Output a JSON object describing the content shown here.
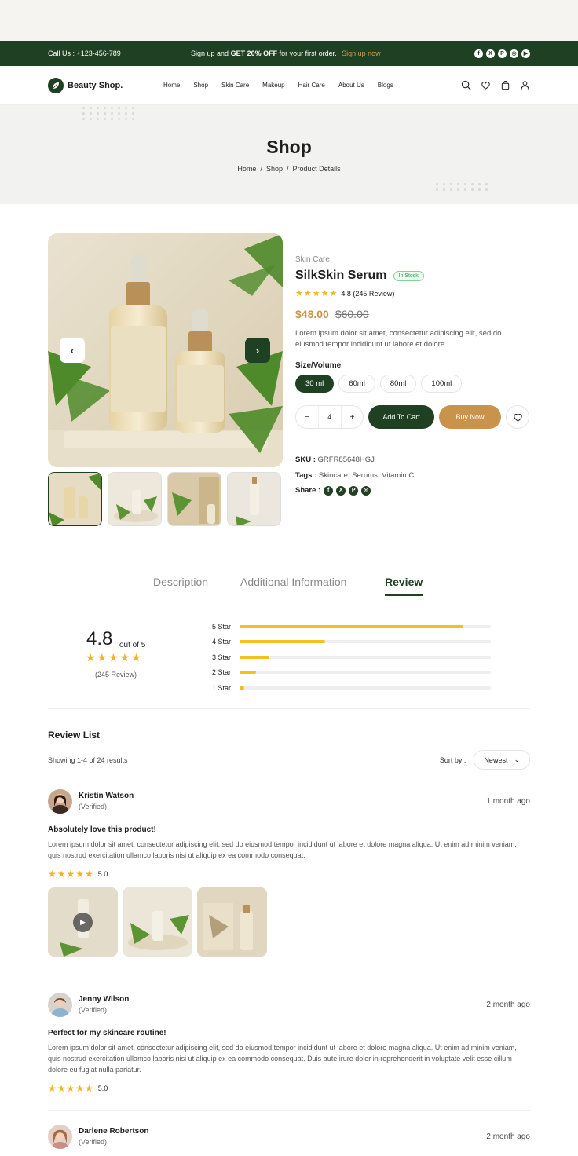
{
  "topbar": {
    "call": "Call Us : +123-456-789",
    "promo_prefix": "Sign up and",
    "promo_bold": "GET 20% OFF",
    "promo_suffix": "for your first order.",
    "promo_link": "Sign up now",
    "socials": [
      "facebook-icon",
      "x-icon",
      "pinterest-icon",
      "instagram-icon",
      "youtube-icon"
    ]
  },
  "nav": {
    "brand": "Beauty Shop.",
    "menu": [
      "Home",
      "Shop",
      "Skin Care",
      "Makeup",
      "Hair Care",
      "About Us",
      "Blogs"
    ],
    "icons": [
      "search-icon",
      "heart-icon",
      "bag-icon",
      "user-icon"
    ]
  },
  "hero": {
    "title": "Shop",
    "crumbs": [
      "Home",
      "Shop",
      "Product Details"
    ]
  },
  "product": {
    "category": "Skin Care",
    "name": "SilkSkin Serum",
    "stock": "In Stock",
    "rating_text": "4.8 (245 Review)",
    "rating_value": 4.8,
    "price": "$48.00",
    "old_price": "$60.00",
    "description": "Lorem ipsum dolor sit amet, consectetur adipiscing elit, sed do eiusmod tempor incididunt ut labore et dolore.",
    "size_label": "Size/Volume",
    "sizes": [
      "30 ml",
      "60ml",
      "80ml",
      "100ml"
    ],
    "selected_size": "30 ml",
    "quantity": "4",
    "add_to_cart": "Add To Cart",
    "buy_now": "Buy Now",
    "sku_label": "SKU :",
    "sku": "GRFR85648HGJ",
    "tags_label": "Tags :",
    "tags": "Skincare, Serums, Vitamin C",
    "share_label": "Share :"
  },
  "tabs": {
    "items": [
      "Description",
      "Additional Information",
      "Review"
    ],
    "active": "Review"
  },
  "summary": {
    "score": "4.8",
    "out_of": "out of 5",
    "count": "(245 Review)",
    "bars": [
      {
        "label": "5 Star",
        "fraction": 0.89
      },
      {
        "label": "4 Star",
        "fraction": 0.34
      },
      {
        "label": "3 Star",
        "fraction": 0.12
      },
      {
        "label": "2 Star",
        "fraction": 0.065
      },
      {
        "label": "1 Star",
        "fraction": 0.02
      }
    ]
  },
  "reviews_header": {
    "title": "Review List",
    "showing": "Showing 1-4 of 24 results",
    "sort_label": "Sort by :",
    "sort_value": "Newest"
  },
  "reviews": [
    {
      "name": "Kristin Watson",
      "verified": "(Verified)",
      "time": "1 month ago",
      "title": "Absolutely love this product!",
      "body": "Lorem ipsum dolor sit amet, consectetur adipiscing elit, sed do eiusmod tempor incididunt ut labore et dolore magna aliqua. Ut enim ad minim veniam, quis nostrud exercitation ullamco laboris nisi ut aliquip ex ea commodo consequat.",
      "score": "5.0"
    },
    {
      "name": "Jenny Wilson",
      "verified": "(Verified)",
      "time": "2 month ago",
      "title": "Perfect for my skincare routine!",
      "body": "Lorem ipsum dolor sit amet, consectetur adipiscing elit, sed do eiusmod tempor incididunt ut labore et dolore magna aliqua. Ut enim ad minim veniam, quis nostrud exercitation ullamco laboris nisi ut aliquip ex ea commodo consequat. Duis aute irure dolor in reprehenderit in voluptate velit esse cillum dolore eu fugiat nulla pariatur.",
      "score": "5.0"
    },
    {
      "name": "Darlene Robertson",
      "verified": "(Verified)",
      "time": "2 month ago"
    }
  ],
  "colors": {
    "brand_green": "#1f4023",
    "accent_gold": "#c9934b",
    "star": "#f3b51e"
  }
}
